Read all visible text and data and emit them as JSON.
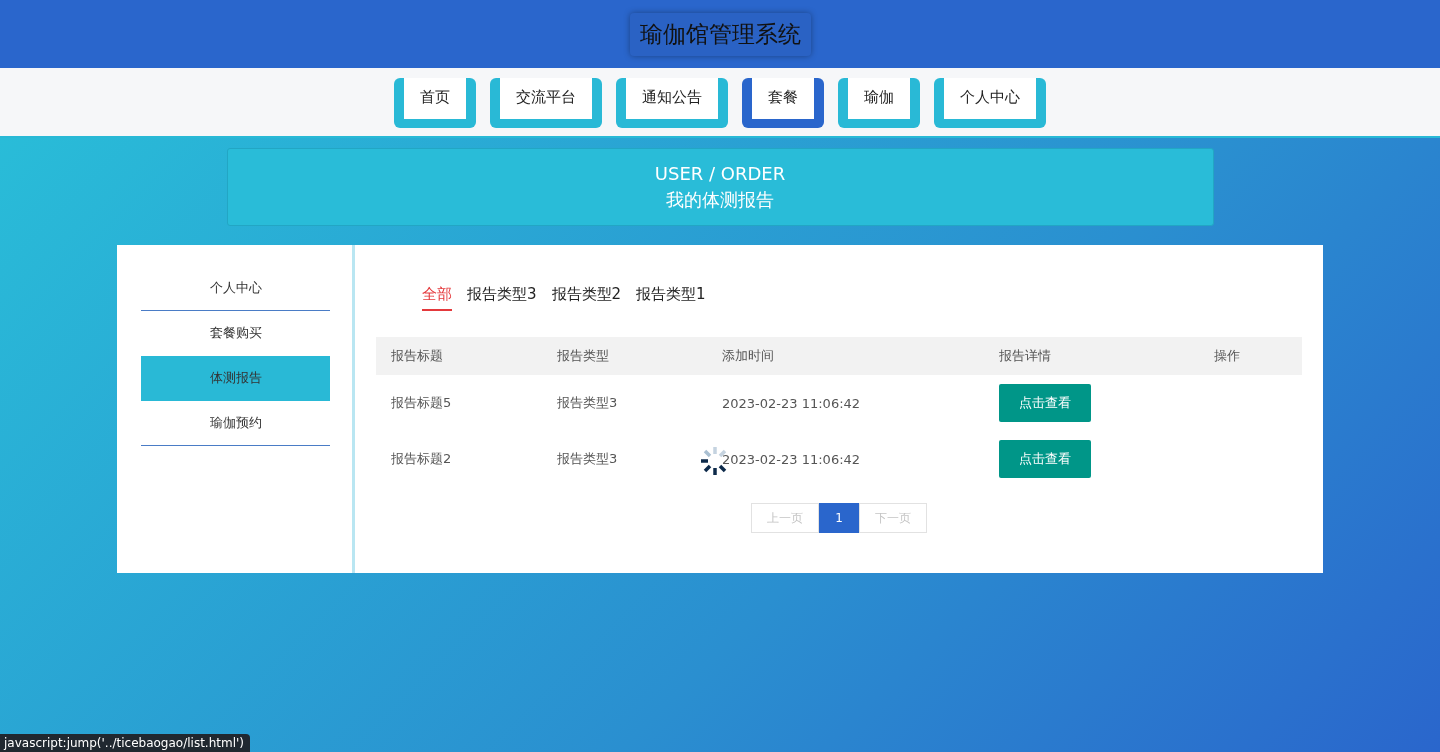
{
  "header": {
    "title": "瑜伽馆管理系统"
  },
  "nav": [
    {
      "label": "首页",
      "selected": false
    },
    {
      "label": "交流平台",
      "selected": false
    },
    {
      "label": "通知公告",
      "selected": false
    },
    {
      "label": "套餐",
      "selected": true
    },
    {
      "label": "瑜伽",
      "selected": false
    },
    {
      "label": "个人中心",
      "selected": false
    }
  ],
  "banner": {
    "subtitle": "USER / ORDER",
    "title": "我的体测报告"
  },
  "sidebar": {
    "items": [
      {
        "label": "个人中心",
        "selected": false
      },
      {
        "label": "套餐购买",
        "selected": false
      },
      {
        "label": "体测报告",
        "selected": true
      },
      {
        "label": "瑜伽预约",
        "selected": false
      }
    ]
  },
  "filters": [
    {
      "label": "全部",
      "selected": true
    },
    {
      "label": "报告类型3",
      "selected": false
    },
    {
      "label": "报告类型2",
      "selected": false
    },
    {
      "label": "报告类型1",
      "selected": false
    }
  ],
  "table": {
    "columns": [
      "报告标题",
      "报告类型",
      "添加时间",
      "报告详情",
      "操作"
    ],
    "rows": [
      {
        "title": "报告标题5",
        "type": "报告类型3",
        "time": "2023-02-23 11:06:42",
        "action": "点击查看"
      },
      {
        "title": "报告标题2",
        "type": "报告类型3",
        "time": "2023-02-23 11:06:42",
        "action": "点击查看"
      }
    ]
  },
  "pagination": {
    "prev": {
      "label": "上一页",
      "disabled": true
    },
    "pages": [
      {
        "label": "1",
        "selected": true
      }
    ],
    "next": {
      "label": "下一页",
      "disabled": true
    }
  },
  "loading": true,
  "status_bar": {
    "text": "javascript:jump('../ticebaogao/list.html')"
  }
}
